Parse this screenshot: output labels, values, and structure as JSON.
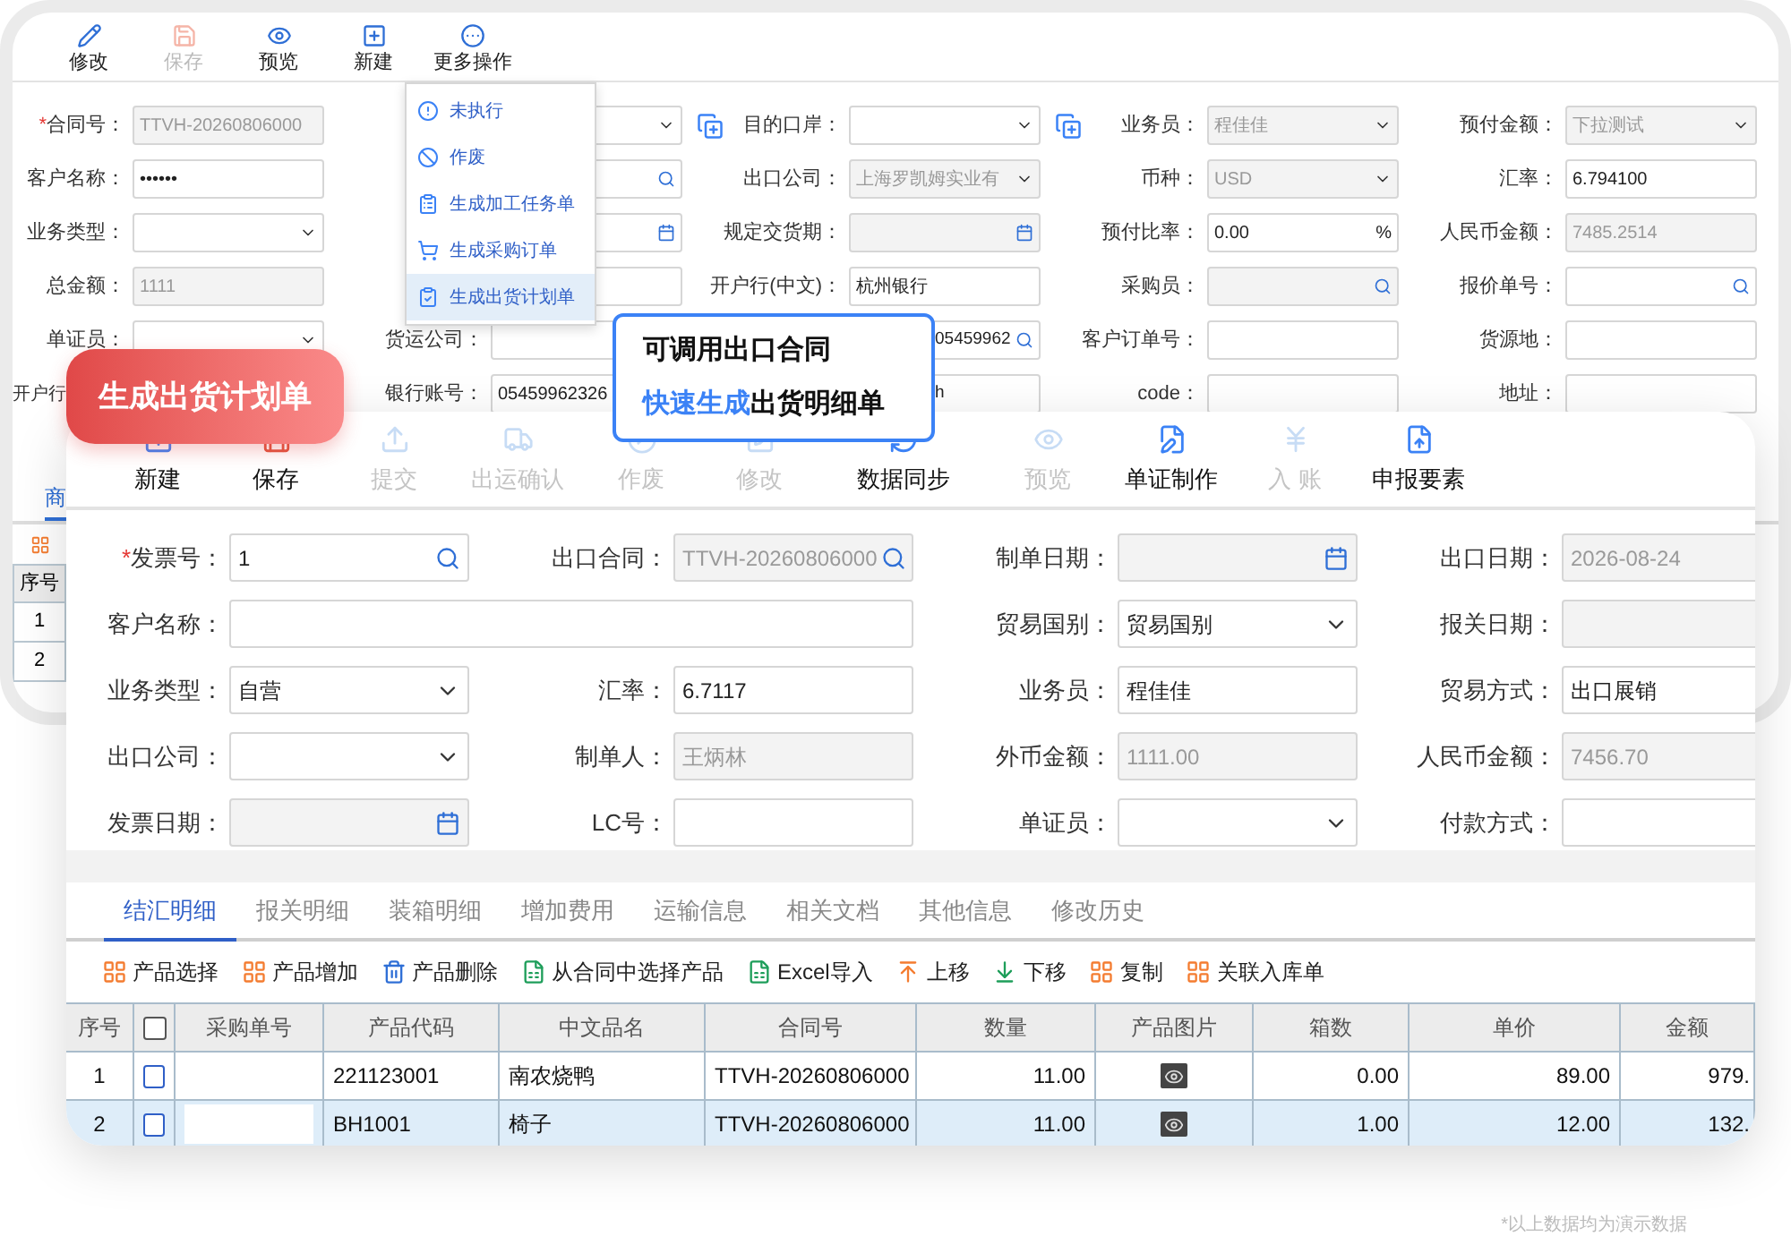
{
  "back": {
    "toolbar": [
      {
        "label": "修改",
        "disabled": false
      },
      {
        "label": "保存",
        "disabled": true
      },
      {
        "label": "预览",
        "disabled": false
      },
      {
        "label": "新建",
        "disabled": false
      },
      {
        "label": "更多操作",
        "disabled": false
      }
    ],
    "form": [
      [
        {
          "label": "合同号：",
          "required_mark": "*",
          "value": "TTVH-20260806000",
          "kind": "text",
          "disabled": true
        },
        {
          "kind": "select",
          "plus": true
        },
        {
          "label": "目的口岸：",
          "kind": "select",
          "plus": true
        },
        {
          "label": "业务员：",
          "value": "程佳佳",
          "kind": "select",
          "disabled": true
        },
        {
          "label": "预付金额：",
          "value": "下拉测试",
          "kind": "select",
          "disabled": true
        }
      ],
      [
        {
          "label": "客户名称：",
          "value": "••••••",
          "kind": "text"
        },
        {
          "kind": "search"
        },
        {
          "label": "出口公司：",
          "value": "上海罗凯姆实业有",
          "kind": "select",
          "disabled": true
        },
        {
          "label": "币种：",
          "value": "USD",
          "kind": "select",
          "disabled": true
        },
        {
          "label": "汇率：",
          "value": "6.794100",
          "kind": "text"
        }
      ],
      [
        {
          "label": "业务类型：",
          "kind": "select"
        },
        {
          "kind": "date"
        },
        {
          "label": "规定交货期：",
          "kind": "date",
          "disabled": true
        },
        {
          "label": "预付比率：",
          "value": "0.00",
          "kind": "percent",
          "suffix": "%"
        },
        {
          "label": "人民币金额：",
          "value": "7485.2514",
          "kind": "text",
          "disabled": true
        }
      ],
      [
        {
          "label": "总金额：",
          "value": "1111",
          "kind": "text",
          "disabled": true
        },
        {
          "kind": "text"
        },
        {
          "label": "开户行(中文)：",
          "value": "杭州银行",
          "kind": "text"
        },
        {
          "label": "采购员：",
          "kind": "search",
          "disabled": true
        },
        {
          "label": "报价单号：",
          "kind": "search"
        }
      ],
      [
        {
          "label": "单证员：",
          "kind": "select"
        },
        {
          "label": "货运公司：",
          "kind": "text"
        },
        {
          "value": "05459962",
          "kind": "search",
          "indent": true
        },
        {
          "label": "客户订单号：",
          "kind": "text"
        },
        {
          "label": "货源地：",
          "kind": "text"
        }
      ],
      [
        {
          "label": "开户行",
          "kind": "none"
        },
        {
          "label": "银行账号：",
          "value": "05459962326",
          "kind": "text"
        },
        {
          "value": "h",
          "kind": "text",
          "indent": true
        },
        {
          "label": "code：",
          "kind": "text"
        },
        {
          "label": "地址：",
          "kind": "text"
        }
      ]
    ],
    "tab": {
      "label": "商",
      "selected": true
    },
    "table": {
      "header": "序号",
      "rows": [
        "1",
        "2"
      ]
    }
  },
  "menu": [
    {
      "label": "未执行",
      "selected": false
    },
    {
      "label": "作废",
      "selected": false
    },
    {
      "label": "生成加工任务单",
      "selected": false
    },
    {
      "label": "生成采购订单",
      "selected": false
    },
    {
      "label": "生成出货计划单",
      "selected": true
    }
  ],
  "badge": "生成出货计划单",
  "callout": [
    "可调用出口合同",
    "**快速生成**出货明细单"
  ],
  "front": {
    "toolbar": [
      {
        "label": "新建",
        "disabled": false
      },
      {
        "label": "保存",
        "disabled": false
      },
      {
        "label": "提交",
        "disabled": true
      },
      {
        "label": "出运确认",
        "disabled": true
      },
      {
        "label": "作废",
        "disabled": true
      },
      {
        "label": "修改",
        "disabled": true
      },
      {
        "label": "数据同步",
        "disabled": false
      },
      {
        "label": "预览",
        "disabled": true
      },
      {
        "label": "单证制作",
        "disabled": false
      },
      {
        "label": "入 账",
        "disabled": true
      },
      {
        "label": "申报要素",
        "disabled": false
      }
    ],
    "form": [
      [
        {
          "label": "发票号：",
          "required_mark": "*",
          "value": "1",
          "kind": "search"
        },
        {
          "label": "出口合同：",
          "value": "TTVH-20260806000",
          "kind": "search",
          "disabled": true
        },
        {
          "label": "制单日期：",
          "kind": "date",
          "disabled": true
        },
        {
          "label": "出口日期：",
          "value": "2026-08-24",
          "kind": "text",
          "disabled": true
        }
      ],
      [
        {
          "label": "客户名称：",
          "kind": "text",
          "wide": true
        },
        {
          "label": "贸易国别：",
          "value": "贸易国别",
          "kind": "select"
        },
        {
          "label": "报关日期：",
          "kind": "text",
          "disabled": true
        }
      ],
      [
        {
          "label": "业务类型：",
          "value": "自营",
          "kind": "select"
        },
        {
          "label": "汇率：",
          "value": "6.7117",
          "kind": "text"
        },
        {
          "label": "业务员：",
          "value": "程佳佳",
          "kind": "text"
        },
        {
          "label": "贸易方式：",
          "value": "出口展销",
          "kind": "text"
        }
      ],
      [
        {
          "label": "出口公司：",
          "kind": "select"
        },
        {
          "label": "制单人：",
          "value": "王炳林",
          "kind": "text",
          "disabled": true
        },
        {
          "label": "外币金额：",
          "value": "1111.00",
          "kind": "text",
          "disabled": true
        },
        {
          "label": "人民币金额：",
          "value": "7456.70",
          "kind": "text",
          "disabled": true
        }
      ],
      [
        {
          "label": "发票日期：",
          "kind": "date",
          "disabled": true
        },
        {
          "label": "LC号：",
          "kind": "text"
        },
        {
          "label": "单证员：",
          "kind": "select"
        },
        {
          "label": "付款方式：",
          "kind": "text"
        }
      ]
    ],
    "tabs": [
      {
        "label": "结汇明细",
        "selected": true
      },
      {
        "label": "报关明细",
        "selected": false
      },
      {
        "label": "装箱明细",
        "selected": false
      },
      {
        "label": "增加费用",
        "selected": false
      },
      {
        "label": "运输信息",
        "selected": false
      },
      {
        "label": "相关文档",
        "selected": false
      },
      {
        "label": "其他信息",
        "selected": false
      },
      {
        "label": "修改历史",
        "selected": false
      }
    ],
    "actions": [
      "产品选择",
      "产品增加",
      "产品删除",
      "从合同中选择产品",
      "Excel导入",
      "上移",
      "下移",
      "复制",
      "关联入库单"
    ],
    "table": {
      "header_checked": false,
      "columns": [
        "序号",
        "",
        "采购单号",
        "产品代码",
        "中文品名",
        "合同号",
        "数量",
        "产品图片",
        "箱数",
        "单价",
        "金额"
      ],
      "rows": [
        {
          "selected": false,
          "checked": false,
          "cells": [
            "1",
            "",
            "",
            "221123001",
            "南农烧鸭",
            "TTVH-20260806000",
            "11.00",
            "",
            "0.00",
            "89.00",
            "979."
          ]
        },
        {
          "selected": true,
          "checked": false,
          "cells": [
            "2",
            "",
            "",
            "BH1001",
            "椅子",
            "TTVH-20260806000",
            "11.00",
            "",
            "1.00",
            "12.00",
            "132."
          ]
        }
      ]
    }
  },
  "footnote": "*以上数据均为演示数据"
}
